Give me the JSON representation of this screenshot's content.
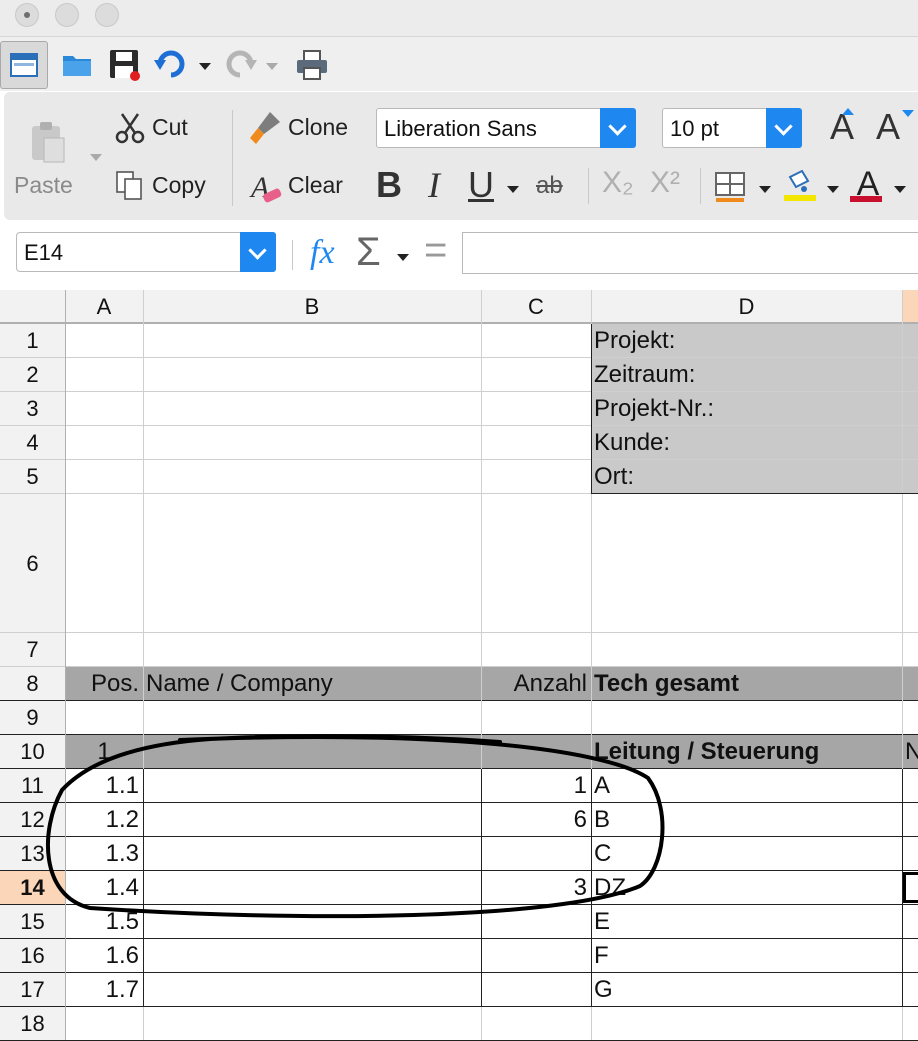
{
  "toolbar": {
    "paste_label": "Paste",
    "cut_label": "Cut",
    "copy_label": "Copy",
    "clone_label": "Clone",
    "clear_label": "Clear",
    "font_name": "Liberation Sans",
    "font_size": "10 pt",
    "bold_glyph": "B",
    "italic_glyph": "I",
    "underline_glyph": "U",
    "strike_glyph": "ab",
    "subscript_glyph": "X₂",
    "superscript_glyph": "X²",
    "grow_glyph": "A",
    "shrink_glyph": "A",
    "font_color_glyph": "A"
  },
  "formula_bar": {
    "name_box": "E14",
    "fx_glyph": "fx",
    "sum_glyph": "Σ",
    "equals_glyph": "=",
    "input_value": ""
  },
  "sheet": {
    "columns": [
      "A",
      "B",
      "C",
      "D"
    ],
    "rows": [
      "1",
      "2",
      "3",
      "4",
      "5",
      "6",
      "7",
      "8",
      "9",
      "10",
      "11",
      "12",
      "13",
      "14",
      "15",
      "16",
      "17",
      "18"
    ],
    "active_row": "14",
    "d1": "Projekt:",
    "d2": "Zeitraum:",
    "d3": "Projekt-Nr.:",
    "d4": "Kunde:",
    "d5": "Ort:",
    "a8": "Pos.",
    "b8": "Name /  Company",
    "c8": "Anzahl",
    "d8": "Tech gesamt",
    "a10": "1",
    "d10": "Leitung / Steuerung",
    "e10": "N",
    "a11": "1.1",
    "c11": "1",
    "d11": "A",
    "a12": "1.2",
    "c12": "6",
    "d12": "B",
    "a13": "1.3",
    "d13": "C",
    "a14": "1.4",
    "c14": "3",
    "d14": "DZ",
    "a15": "1.5",
    "d15": "E",
    "a16": "1.6",
    "d16": "F",
    "a17": "1.7",
    "d17": "G"
  },
  "colors": {
    "header_band": "#a6a6a6",
    "project_block": "#c9c9c9",
    "accent_blue": "#1e88f0",
    "active_header": "#fbd6b8",
    "annotation_ink": "#000000"
  }
}
